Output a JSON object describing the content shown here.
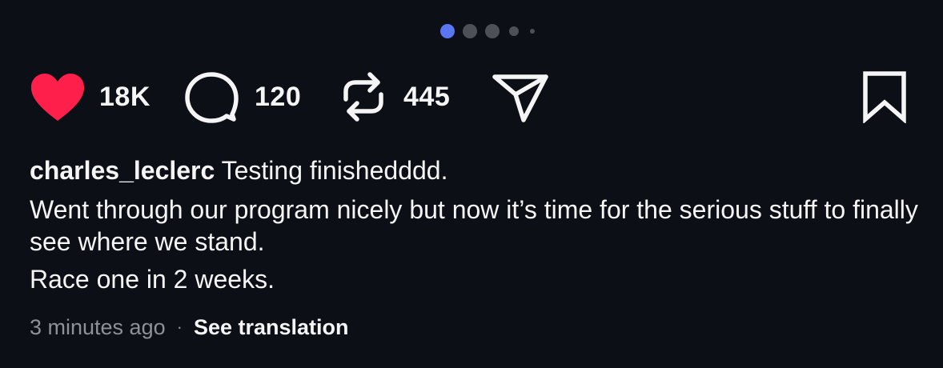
{
  "carousel": {
    "dot_count": 5,
    "active_index": 0,
    "colors": {
      "active": "#5a76f3",
      "inactive": "#4d5057"
    }
  },
  "actions": {
    "like": {
      "icon": "heart-icon",
      "count": "18K",
      "liked": true,
      "color": "#ff1f4b"
    },
    "comment": {
      "icon": "comment-bubble-icon",
      "count": "120"
    },
    "repost": {
      "icon": "repost-icon",
      "count": "445"
    },
    "share": {
      "icon": "paper-plane-icon"
    },
    "save": {
      "icon": "bookmark-icon"
    }
  },
  "post": {
    "username": "charles_leclerc",
    "caption_first": "Testing finishedddd.",
    "caption_second": "Went through our program nicely but now it’s time for the serious stuff to finally see where we stand.",
    "caption_third": "Race one in 2 weeks."
  },
  "meta": {
    "timestamp": "3 minutes ago",
    "separator": "·",
    "translation_link": "See translation"
  },
  "theme": {
    "background": "#0c0f15",
    "text": "#f5f5f5",
    "muted": "#8e9199"
  }
}
